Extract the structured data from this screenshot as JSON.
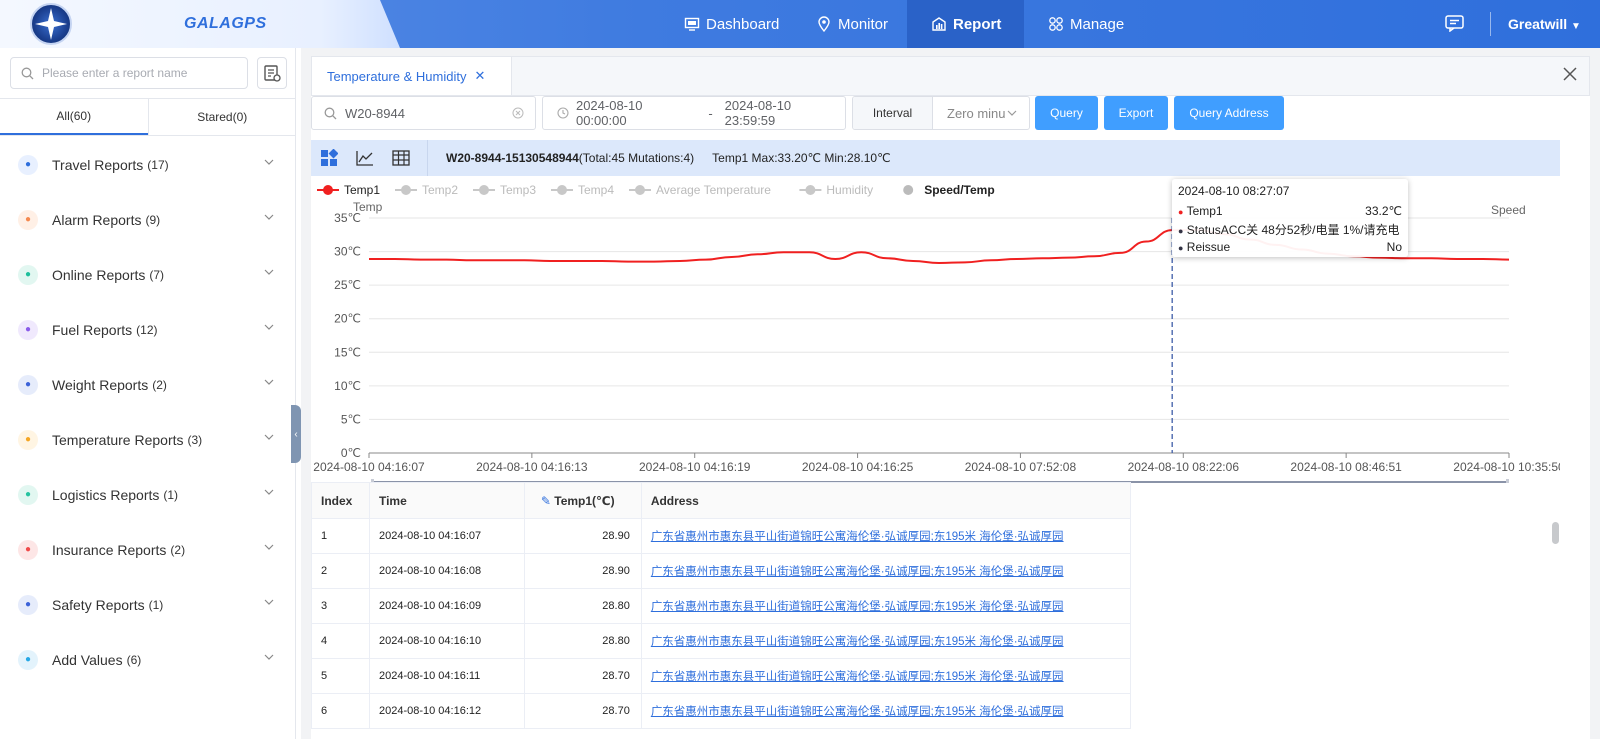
{
  "app": {
    "brand": "GALAGPS",
    "nav": [
      {
        "label": "Dashboard",
        "icon": "monitor-screen-icon",
        "active": false
      },
      {
        "label": "Monitor",
        "icon": "location-pin-icon",
        "active": false
      },
      {
        "label": "Report",
        "icon": "report-chart-icon",
        "active": true
      },
      {
        "label": "Manage",
        "icon": "grid-apps-icon",
        "active": false
      }
    ],
    "user": "Greatwill"
  },
  "sidebar": {
    "search_placeholder": "Please enter a report name",
    "tabs": [
      {
        "label": "All(60)",
        "active": true
      },
      {
        "label": "Stared(0)",
        "active": false
      }
    ],
    "categories": [
      {
        "label": "Travel Reports",
        "count": "(17)",
        "icon": "navigation-arrow-icon",
        "color": "#2f6fdc",
        "bg": "#e8f0ff"
      },
      {
        "label": "Alarm Reports",
        "count": "(9)",
        "icon": "bell-icon",
        "color": "#f5894f",
        "bg": "#fff0e6"
      },
      {
        "label": "Online Reports",
        "count": "(7)",
        "icon": "online-icon",
        "color": "#1fbf9c",
        "bg": "#e2f7f1"
      },
      {
        "label": "Fuel Reports",
        "count": "(12)",
        "icon": "fuel-drop-icon",
        "color": "#8a5bea",
        "bg": "#f0e9fd"
      },
      {
        "label": "Weight Reports",
        "count": "(2)",
        "icon": "weight-icon",
        "color": "#3d63d8",
        "bg": "#e6ecfb"
      },
      {
        "label": "Temperature Reports",
        "count": "(3)",
        "icon": "thermometer-icon",
        "color": "#f5a623",
        "bg": "#fff5e3"
      },
      {
        "label": "Logistics Reports",
        "count": "(1)",
        "icon": "truck-icon",
        "color": "#27c3a0",
        "bg": "#e2f7f1"
      },
      {
        "label": "Insurance Reports",
        "count": "(2)",
        "icon": "shield-icon",
        "color": "#f04a4a",
        "bg": "#fde6e6"
      },
      {
        "label": "Safety Reports",
        "count": "(1)",
        "icon": "users-icon",
        "color": "#3d63d8",
        "bg": "#e6ecfb"
      },
      {
        "label": "Add Values",
        "count": "(6)",
        "icon": "plus-value-icon",
        "color": "#26a8e6",
        "bg": "#e3f3fc"
      }
    ]
  },
  "main": {
    "open_tab": "Temperature & Humidity",
    "filters": {
      "vehicle": "W20-8944",
      "start": "2024-08-10 00:00:00",
      "dash": "-",
      "end": "2024-08-10 23:59:59",
      "interval_label": "Interval",
      "interval_value": "Zero minu"
    },
    "buttons": {
      "query": "Query",
      "export": "Export",
      "query_address": "Query Address"
    },
    "info": {
      "device": "W20-8944-15130548944",
      "summary": "(Total:45 Mutations:4)",
      "temp_stats": "Temp1 Max:33.20℃ Min:28.10℃"
    },
    "tooltip": {
      "time": "2024-08-10 08:27:07",
      "rows": [
        {
          "label": "Temp1",
          "value": "33.2℃",
          "color": "#f02020"
        },
        {
          "label": "StatusACC关 48分52秒/电量 1%/请充电",
          "value": "",
          "color": "#334"
        },
        {
          "label": "Reissue",
          "value": "No",
          "color": "#334"
        }
      ]
    },
    "table": {
      "headers": [
        "Index",
        "Time",
        "Temp1(℃)",
        "Address"
      ],
      "rows": [
        {
          "index": "1",
          "time": "2024-08-10 04:16:07",
          "temp": "28.90",
          "address": "广东省惠州市惠东县平山街道锦旺公寓海伦堡·弘诚厚园;东195米 海伦堡·弘诚厚园"
        },
        {
          "index": "2",
          "time": "2024-08-10 04:16:08",
          "temp": "28.90",
          "address": "广东省惠州市惠东县平山街道锦旺公寓海伦堡·弘诚厚园;东195米 海伦堡·弘诚厚园"
        },
        {
          "index": "3",
          "time": "2024-08-10 04:16:09",
          "temp": "28.80",
          "address": "广东省惠州市惠东县平山街道锦旺公寓海伦堡·弘诚厚园;东195米 海伦堡·弘诚厚园"
        },
        {
          "index": "4",
          "time": "2024-08-10 04:16:10",
          "temp": "28.80",
          "address": "广东省惠州市惠东县平山街道锦旺公寓海伦堡·弘诚厚园;东195米 海伦堡·弘诚厚园"
        },
        {
          "index": "5",
          "time": "2024-08-10 04:16:11",
          "temp": "28.70",
          "address": "广东省惠州市惠东县平山街道锦旺公寓海伦堡·弘诚厚园;东195米 海伦堡·弘诚厚园"
        },
        {
          "index": "6",
          "time": "2024-08-10 04:16:12",
          "temp": "28.70",
          "address": "广东省惠州市惠东县平山街道锦旺公寓海伦堡·弘诚厚园;东195米 海伦堡·弘诚厚园"
        }
      ]
    }
  },
  "chart_data": {
    "type": "line",
    "title": "",
    "legend": [
      {
        "name": "Temp1",
        "active": true,
        "color": "#f02020"
      },
      {
        "name": "Temp2",
        "active": false,
        "color": "#c8c8c8"
      },
      {
        "name": "Temp3",
        "active": false,
        "color": "#c8c8c8"
      },
      {
        "name": "Temp4",
        "active": false,
        "color": "#c8c8c8"
      },
      {
        "name": "Average Temperature",
        "active": false,
        "color": "#c8c8c8"
      },
      {
        "name": "Humidity",
        "active": false,
        "color": "#c8c8c8"
      },
      {
        "name": "Speed/Temp",
        "active": true,
        "color": "#bbbbbb"
      }
    ],
    "legend_placement": "top-left",
    "ylabel_left": "Temp",
    "ylabel_right": "Speed",
    "ylim": [
      0,
      35
    ],
    "yticks": [
      "0℃",
      "5℃",
      "10℃",
      "15℃",
      "20℃",
      "25℃",
      "30℃",
      "35℃"
    ],
    "xticks": [
      "2024-08-10 04:16:07",
      "2024-08-10 04:16:13",
      "2024-08-10 04:16:19",
      "2024-08-10 04:16:25",
      "2024-08-10 07:52:08",
      "2024-08-10 08:22:06",
      "2024-08-10 08:46:51",
      "2024-08-10 10:35:50"
    ],
    "grid": true,
    "hover_index": 31,
    "series": [
      {
        "name": "Temp1",
        "color": "#f02020",
        "values": [
          28.9,
          28.9,
          28.8,
          28.8,
          28.7,
          28.7,
          28.7,
          28.6,
          28.6,
          28.6,
          28.5,
          28.5,
          28.6,
          28.8,
          29.2,
          29.6,
          29.9,
          29.9,
          28.9,
          29.9,
          29.0,
          28.6,
          28.3,
          28.4,
          28.7,
          28.9,
          29.0,
          29.1,
          29.3,
          29.8,
          31.5,
          33.2,
          33.2,
          32.6,
          31.8,
          31.0,
          30.3,
          29.7,
          29.3,
          29.1,
          29.0,
          29.0,
          28.9,
          28.9,
          28.8
        ]
      }
    ]
  }
}
